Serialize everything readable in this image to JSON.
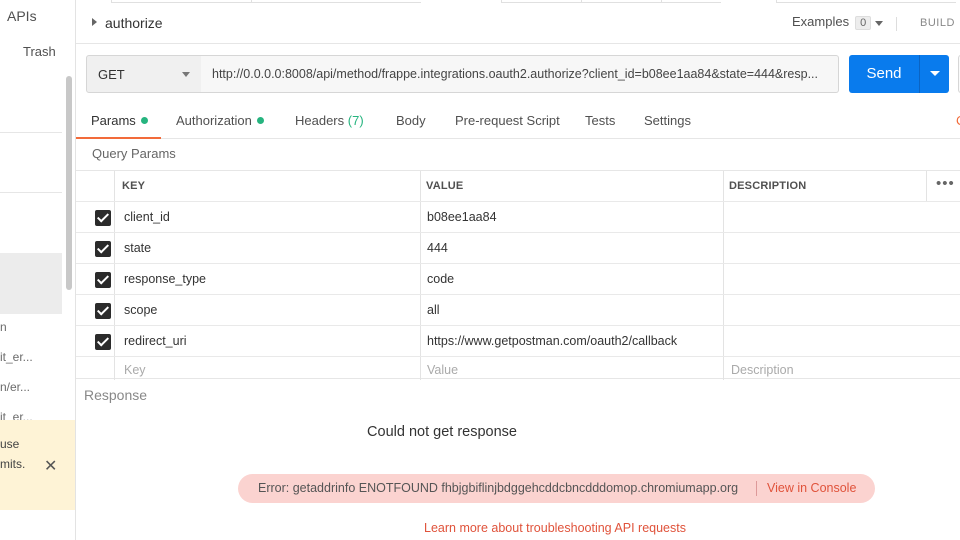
{
  "sidebar": {
    "apis_label": "APIs",
    "trash_label": "Trash",
    "items": [
      "n",
      "it_er...",
      "n/er...",
      "it_er..."
    ],
    "banner_line1": "use",
    "banner_line2": "mits.",
    "close_glyph": "✕"
  },
  "header": {
    "title": "authorize",
    "examples_label": "Examples",
    "examples_count": "0",
    "build_label": "BUILD"
  },
  "request": {
    "method": "GET",
    "url": "http://0.0.0.0:8008/api/method/frappe.integrations.oauth2.authorize?client_id=b08ee1aa84&state=444&resp...",
    "send_label": "Send"
  },
  "tabs": {
    "params": "Params",
    "authorization": "Authorization",
    "headers": "Headers",
    "headers_count": "(7)",
    "body": "Body",
    "prerequest": "Pre-request Script",
    "tests": "Tests",
    "settings": "Settings",
    "cookies_edge": "C"
  },
  "query_params": {
    "label": "Query Params",
    "columns": {
      "key": "KEY",
      "value": "VALUE",
      "description": "DESCRIPTION"
    },
    "more_glyph": "•••",
    "rows": [
      {
        "key": "client_id",
        "value": "b08ee1aa84",
        "checked": true
      },
      {
        "key": "state",
        "value": "444",
        "checked": true
      },
      {
        "key": "response_type",
        "value": "code",
        "checked": true
      },
      {
        "key": "scope",
        "value": "all",
        "checked": true
      },
      {
        "key": "redirect_uri",
        "value": "https://www.getpostman.com/oauth2/callback",
        "checked": true
      }
    ],
    "placeholders": {
      "key": "Key",
      "value": "Value",
      "description": "Description"
    }
  },
  "response": {
    "label": "Response",
    "status": "Could not get response",
    "error": "Error: getaddrinfo ENOTFOUND fhbjgbiflinjbdggehcddcbncdddomop.chromiumapp.org",
    "console_link": "View in Console",
    "learn_more": "Learn more about troubleshooting API requests"
  },
  "colors": {
    "send": "#097bed",
    "active_tab": "#f26b3a",
    "status_dot": "#26b47f",
    "error_bg": "#fbd3d0",
    "link": "#e0533b",
    "banner_bg": "#fef3d6"
  }
}
